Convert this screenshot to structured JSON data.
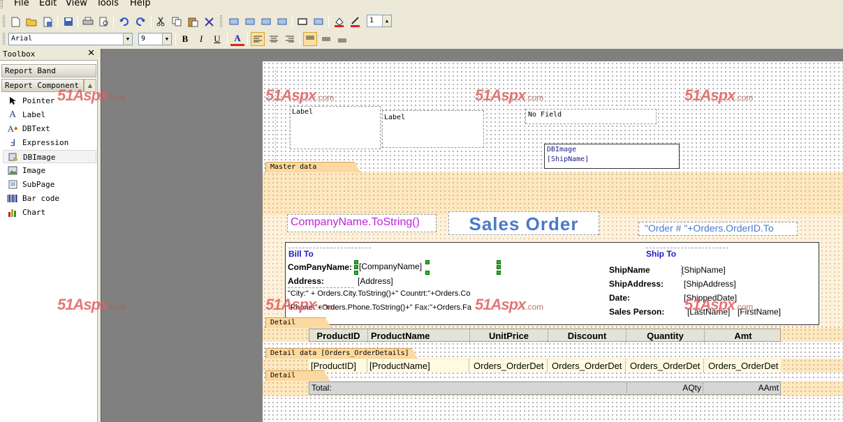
{
  "menu": {
    "file": "File",
    "edit": "Edit",
    "view": "View",
    "tools": "Tools",
    "help": "Help"
  },
  "toolbar": {
    "line_width_value": "1"
  },
  "format_toolbar": {
    "font_name": "Arial",
    "font_size": "9",
    "bold": "B",
    "italic": "I",
    "underline": "U",
    "font_color": "A"
  },
  "toolbox": {
    "title": "Toolbox",
    "close": "✕",
    "report_band": "Report Band",
    "report_component": "Report Component",
    "tools": [
      "Pointer",
      "Label",
      "DBText",
      "Expression",
      "DBImage",
      "Image",
      "SubPage",
      "Bar code",
      "Chart"
    ]
  },
  "watermark": {
    "brand": "51Aspx",
    "suffix": ".com"
  },
  "report": {
    "title_band": {
      "label1": "Label",
      "label2": "Label",
      "no_field": "No Field",
      "dbimage_title": "DBImage",
      "dbimage_field": "[ShipName]"
    },
    "master_band": {
      "tab": "Master data [Orders]",
      "company_expr": "CompanyName.ToString()",
      "sales_order": "Sales Order",
      "order_expr": "\"Order # \"+Orders.OrderID.To",
      "bill_to": "Bill To",
      "ship_to": "Ship To",
      "company_label": "ComPanyName:",
      "company_field": "[CompanyName]",
      "address_label": "Address:",
      "address_field": "[Address]",
      "city_expr": "\"City:\" + Orders.City.ToString()+\"  Countrt:\"+Orders.Co",
      "phone_expr": "\"Phone:\"+Orders.Phone.ToString()+\" Fax:\"+Orders.Fa",
      "shipname_label": "ShipName",
      "shipname_field": "[ShipName]",
      "shipaddress_label": "ShipAddress:",
      "shipaddress_field": "[ShipAddress]",
      "date_label": "Date:",
      "date_field": "[ShippedDate]",
      "salesperson_label": "Sales Person:",
      "lastname_field": "[LastName]",
      "firstname_field": "[FirstName]"
    },
    "detail_header": {
      "tab": "Detail header",
      "columns": [
        "ProductID",
        "ProductName",
        "UnitPrice",
        "Discount",
        "Quantity",
        "Amt"
      ]
    },
    "detail_data": {
      "tab": "Detail data [Orders_OrderDetails]",
      "cells": [
        "[ProductID]",
        "[ProductName]",
        "Orders_OrderDet",
        "Orders_OrderDet",
        "Orders_OrderDet",
        "Orders_OrderDet"
      ]
    },
    "detail_footer": {
      "tab": "Detail footer",
      "total": "Total:",
      "aqty": "AQty",
      "aamt": "AAmt"
    }
  }
}
